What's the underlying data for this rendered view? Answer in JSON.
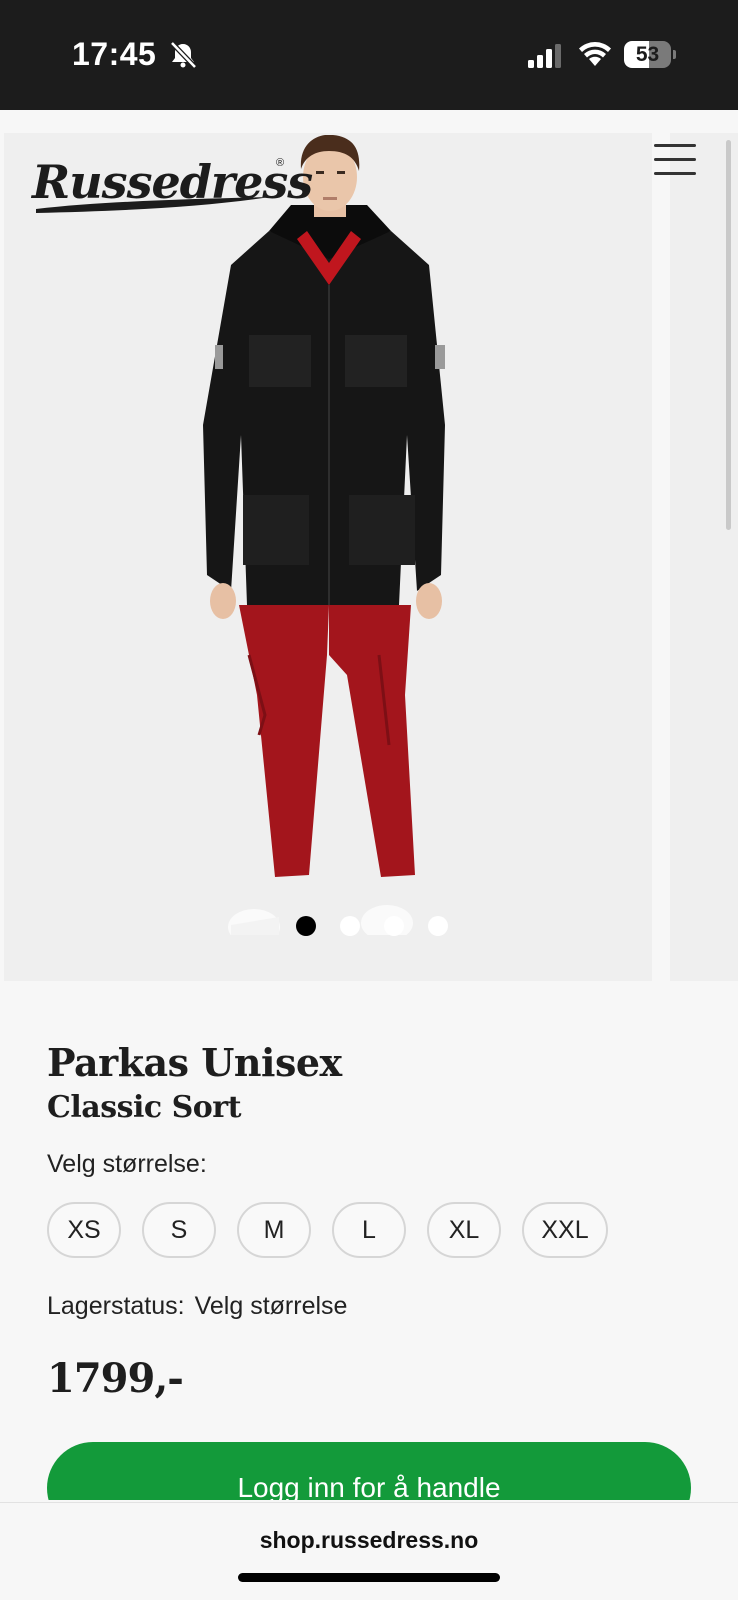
{
  "status": {
    "time": "17:45",
    "battery": "53",
    "battery_level": 0.53
  },
  "header": {
    "logo_text": "Russedress",
    "logo_mark": "®"
  },
  "gallery": {
    "image_count": 4,
    "active_index": 0
  },
  "product": {
    "title": "Parkas Unisex",
    "subtitle": "Classic Sort",
    "size_label": "Velg størrelse:",
    "sizes": [
      "XS",
      "S",
      "M",
      "L",
      "XL",
      "XXL"
    ],
    "stock_label": "Lagerstatus:",
    "stock_value": "Velg størrelse",
    "price": "1799,-",
    "cta_label": "Logg inn for å handle"
  },
  "browser": {
    "url": "shop.russedress.no"
  },
  "colors": {
    "status_bar": "#1c1c1c",
    "cta": "#139a3a",
    "jacket": "#161616",
    "pants": "#a3151c"
  }
}
